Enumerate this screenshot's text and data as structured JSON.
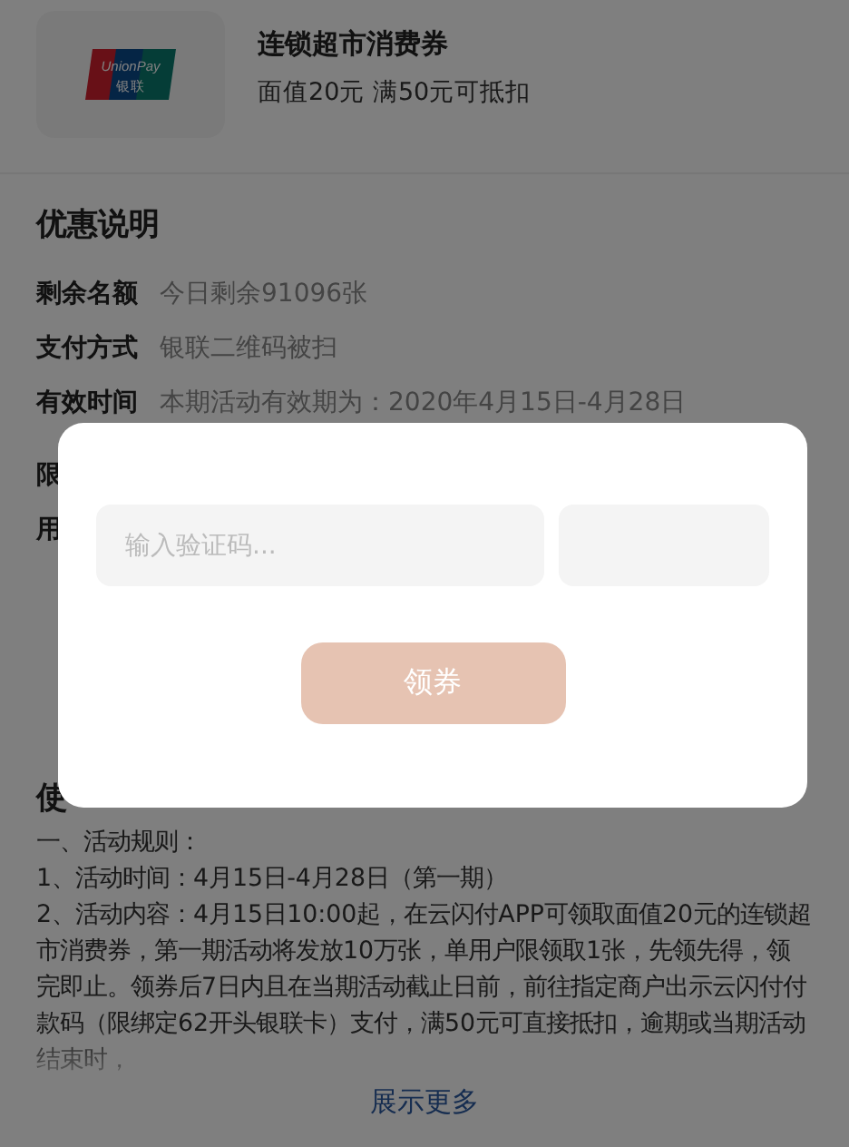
{
  "coupon": {
    "logo": [
      "UnionPay",
      "银联"
    ],
    "title": "连锁超市消费券",
    "subtitle": "面值20元 满50元可抵扣"
  },
  "offer": {
    "heading": "优惠说明",
    "rows": [
      {
        "label": "剩余名额",
        "value": "今日剩余91096张"
      },
      {
        "label": "支付方式",
        "value": "银联二维码被扫"
      },
      {
        "label": "有效时间",
        "value": "本期活动有效期为：2020年4月15日-4月28日"
      }
    ],
    "cut_labels": [
      "限",
      "用"
    ]
  },
  "usage": {
    "heading": "使",
    "paragraphs": [
      "一、活动规则：",
      "1、活动时间：4月15日-4月28日（第一期）",
      "2、活动内容：4月15日10:00起，在云闪付APP可领取面值20元的连锁超市消费券，第一期活动将发放10万张，单用户限领取1张，先领先得，领完即止。领券后7日内且在当期活动截止日前，前往指定商户出示云闪付付款码（限绑定62开头银联卡）支付，满50元可直接抵扣，逾期或当期活动结束时，"
    ],
    "more": "展示更多"
  },
  "dialog": {
    "placeholder": "输入验证码...",
    "button": "领券"
  }
}
